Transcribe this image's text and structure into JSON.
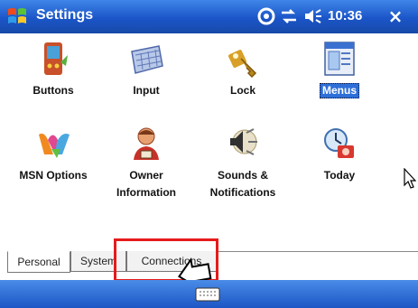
{
  "titlebar": {
    "title": "Settings",
    "time": "10:36",
    "close": "×"
  },
  "items": [
    {
      "label": "Buttons",
      "icon": "buttons-icon"
    },
    {
      "label": "Input",
      "icon": "input-icon"
    },
    {
      "label": "Lock",
      "icon": "lock-icon"
    },
    {
      "label": "Menus",
      "icon": "menus-icon",
      "selected": true
    },
    {
      "label": "MSN Options",
      "icon": "msn-options-icon"
    },
    {
      "label": "Owner Information",
      "line1": "Owner",
      "line2": "Information",
      "icon": "owner-information-icon"
    },
    {
      "label": "Sounds & Notifications",
      "line1": "Sounds &",
      "line2": "Notifications",
      "icon": "sounds-notifications-icon"
    },
    {
      "label": "Today",
      "icon": "today-icon"
    }
  ],
  "tabs": [
    {
      "label": "Personal",
      "active": true
    },
    {
      "label": "System"
    },
    {
      "label": "Connections"
    }
  ],
  "colors": {
    "titlebar": "#1b55c8",
    "highlight": "#e51b1b",
    "selection": "#2e6fd8"
  }
}
